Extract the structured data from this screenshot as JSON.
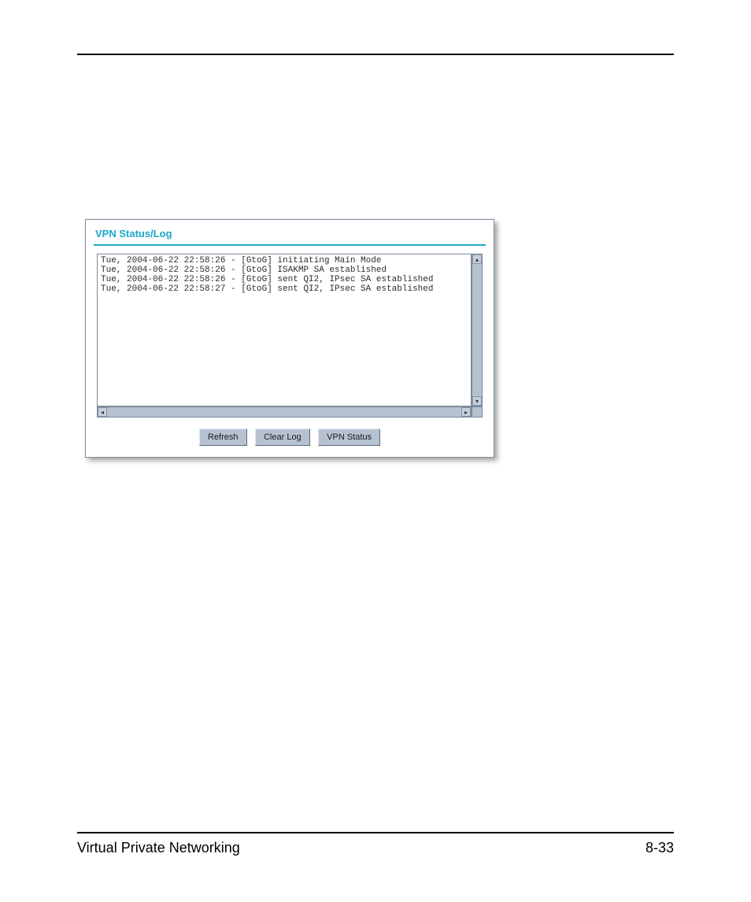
{
  "panel": {
    "title": "VPN Status/Log",
    "log_lines": [
      "Tue, 2004-06-22 22:58:26 - [GtoG] initiating Main Mode",
      "Tue, 2004-06-22 22:58:26 - [GtoG] ISAKMP SA established",
      "Tue, 2004-06-22 22:58:26 - [GtoG] sent QI2, IPsec SA established",
      "Tue, 2004-06-22 22:58:27 - [GtoG] sent QI2, IPsec SA established"
    ],
    "buttons": {
      "refresh": "Refresh",
      "clear_log": "Clear Log",
      "vpn_status": "VPN Status"
    }
  },
  "footer": {
    "left": "Virtual Private Networking",
    "right": "8-33"
  }
}
